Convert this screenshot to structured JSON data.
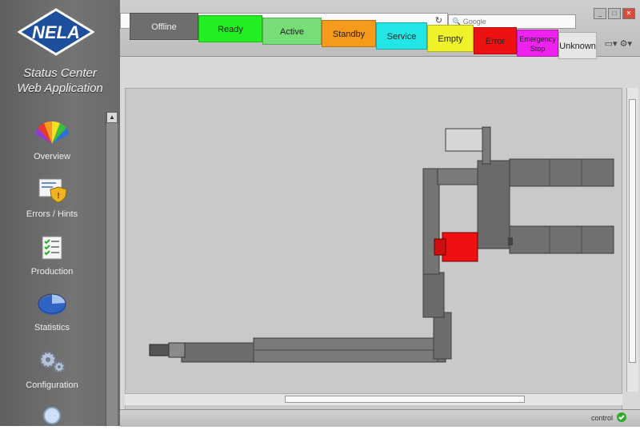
{
  "app": {
    "logo_text": "NELA",
    "title_line1": "Status Center",
    "title_line2": "Web Application"
  },
  "nav": [
    {
      "label": "Overview",
      "icon": "color-fan-icon"
    },
    {
      "label": "Errors / Hints",
      "icon": "shield-warning-icon"
    },
    {
      "label": "Production",
      "icon": "checklist-icon"
    },
    {
      "label": "Statistics",
      "icon": "pie-chart-icon"
    },
    {
      "label": "Configuration",
      "icon": "gears-icon"
    },
    {
      "label": "",
      "icon": "magnifier-icon"
    }
  ],
  "browser": {
    "search_placeholder": "Google",
    "status_text": "control"
  },
  "legend": [
    {
      "label": "Offline",
      "color": "#6e6e6e",
      "text_color": "#eeeeee"
    },
    {
      "label": "Ready",
      "color": "#22ee22",
      "text_color": "#222222"
    },
    {
      "label": "Active",
      "color": "#77dd77",
      "text_color": "#222222"
    },
    {
      "label": "Standby",
      "color": "#f59a1a",
      "text_color": "#222222"
    },
    {
      "label": "Service",
      "color": "#22e5e5",
      "text_color": "#222222"
    },
    {
      "label": "Empty",
      "color": "#eef22a",
      "text_color": "#222222"
    },
    {
      "label": "Error",
      "color": "#ee1111",
      "text_color": "#222222"
    },
    {
      "label": "Emergency Stop",
      "color": "#ee22ee",
      "text_color": "#222222"
    },
    {
      "label": "Unknown",
      "color": "#e6e6e6",
      "text_color": "#222222"
    }
  ]
}
